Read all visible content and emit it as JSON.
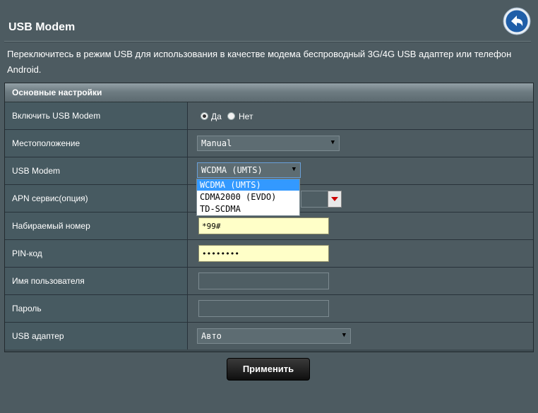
{
  "page": {
    "title": "USB Modem",
    "description": "Переключитесь в режим USB для использования в качестве модема беспроводный 3G/4G USB адаптер или телефон Android.",
    "back_icon": "back-arrow-icon"
  },
  "section": {
    "title": "Основные настройки"
  },
  "rows": {
    "enable": {
      "label": "Включить USB Modem",
      "option_yes": "Да",
      "option_no": "Нет",
      "selected": "Да"
    },
    "location": {
      "label": "Местоположение",
      "value": "Manual"
    },
    "usb_modem": {
      "label": "USB Modem",
      "value": "WCDMA (UMTS)",
      "options": [
        "WCDMA (UMTS)",
        "CDMA2000 (EVDO)",
        "TD-SCDMA"
      ]
    },
    "apn": {
      "label": "APN сервис(опция)",
      "value": ""
    },
    "dial": {
      "label": "Набираемый номер",
      "value": "*99#"
    },
    "pin": {
      "label": "PIN-код",
      "value": "••••••••"
    },
    "username": {
      "label": "Имя пользователя",
      "value": ""
    },
    "password": {
      "label": "Пароль",
      "value": ""
    },
    "adapter": {
      "label": "USB адаптер",
      "value": "Авто"
    }
  },
  "apply_label": "Применить",
  "colors": {
    "background": "#4d5b61",
    "label_cell": "#475a61",
    "input_yellow": "#ffffc8",
    "dropdown_selected": "#3399ff"
  }
}
